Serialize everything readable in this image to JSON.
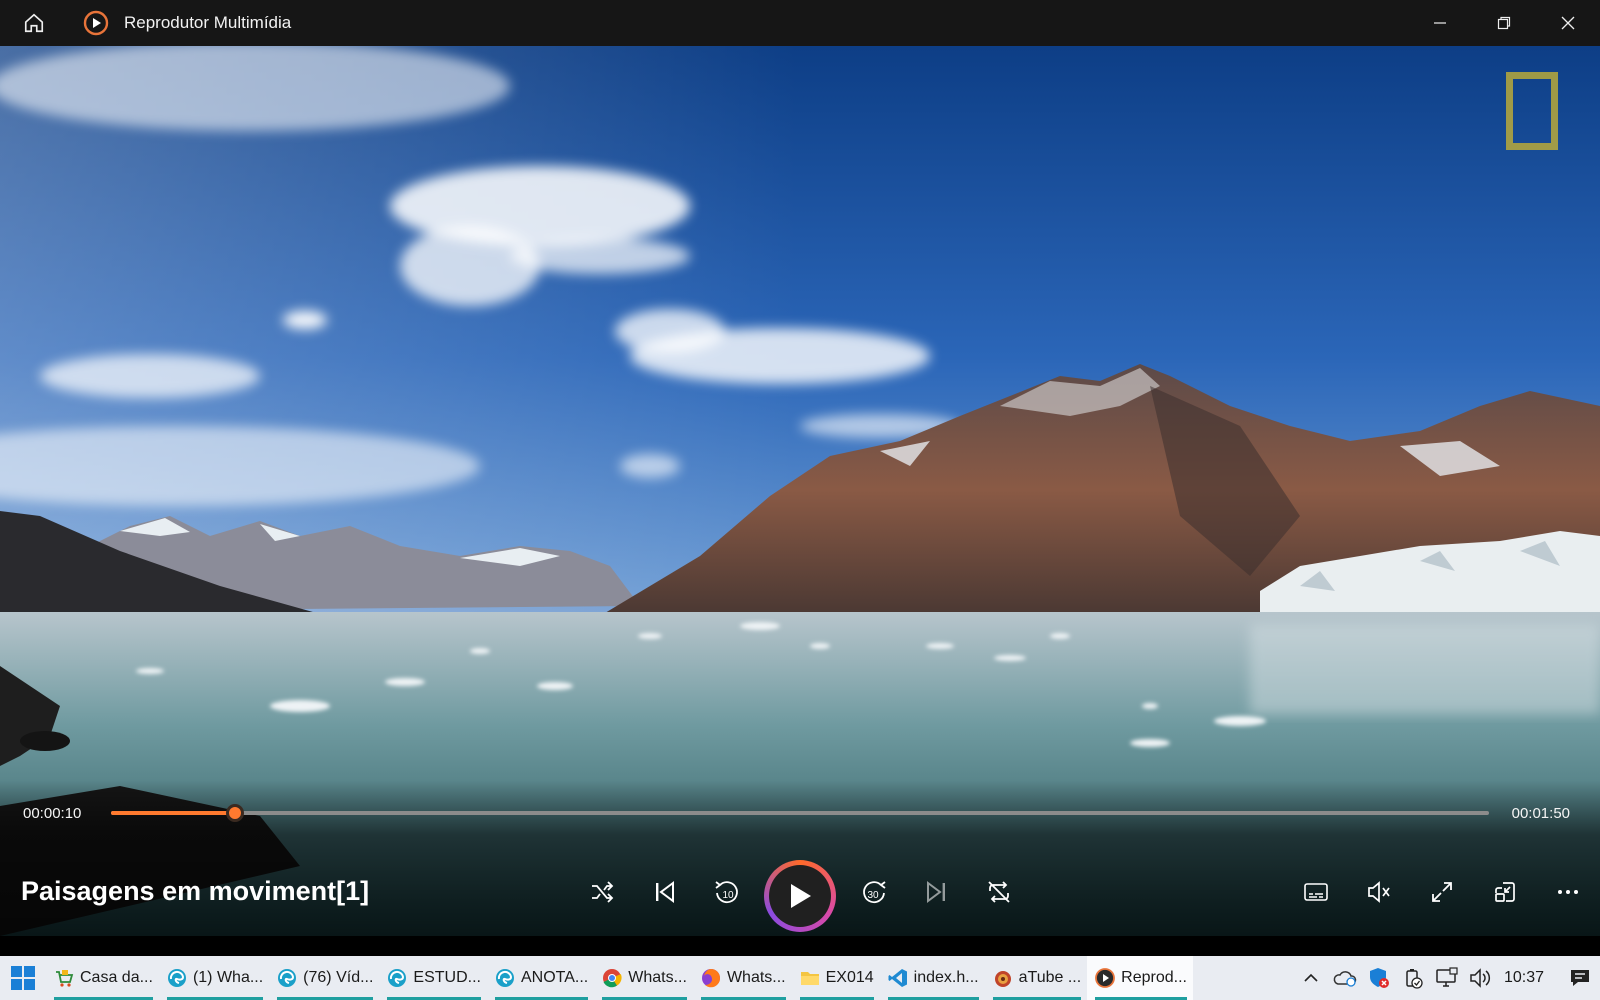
{
  "window": {
    "title": "Reprodutor Multimídia",
    "icons": {
      "home": "home-icon",
      "app": "play-circle-icon"
    },
    "controls": [
      "minimize-icon",
      "maximize-icon",
      "close-icon"
    ]
  },
  "player": {
    "current_time": "00:00:10",
    "total_time": "00:01:50",
    "progress_percent": 9,
    "media_title": "Paisagens em moviment[1]",
    "accent_color": "#ff7a2f",
    "controls": [
      "shuffle-icon",
      "previous-icon",
      "rewind-10-icon",
      "play-icon",
      "forward-30-icon",
      "next-icon",
      "repeat-off-icon"
    ],
    "right_controls": [
      "subtitles-icon",
      "mute-icon",
      "fullscreen-icon",
      "mini-player-icon",
      "more-icon"
    ],
    "rewind_label": "10",
    "forward_label": "30"
  },
  "taskbar": {
    "items": [
      {
        "label": "Casa da...",
        "icon": "cart-icon",
        "active": false
      },
      {
        "label": "(1) Wha...",
        "icon": "edge-icon",
        "active": false
      },
      {
        "label": "(76) Víd...",
        "icon": "edge-icon",
        "active": false
      },
      {
        "label": "ESTUD...",
        "icon": "edge-icon",
        "active": false
      },
      {
        "label": "ANOTA...",
        "icon": "edge-icon",
        "active": false
      },
      {
        "label": "Whats...",
        "icon": "chrome-icon",
        "active": false
      },
      {
        "label": "Whats...",
        "icon": "firefox-icon",
        "active": false
      },
      {
        "label": "EX014",
        "icon": "folder-icon",
        "active": false
      },
      {
        "label": "index.h...",
        "icon": "vscode-icon",
        "active": false
      },
      {
        "label": "aTube ...",
        "icon": "atube-icon",
        "active": false
      },
      {
        "label": "Reprod...",
        "icon": "media-player-icon",
        "active": true
      }
    ],
    "tray_icons": [
      "chevron-up-icon",
      "onedrive-icon",
      "defender-icon",
      "battery-icon",
      "network-icon",
      "volume-icon"
    ],
    "clock": "10:37"
  }
}
